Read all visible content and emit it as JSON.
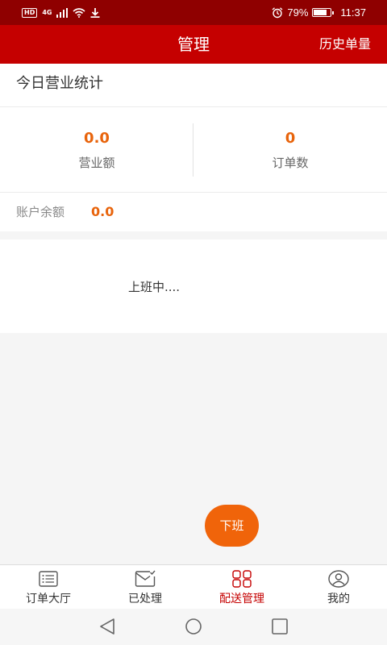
{
  "status_bar": {
    "hd": "HD",
    "network": "4G",
    "battery_percent": "79%",
    "battery_level": 0.79,
    "time": "11:37"
  },
  "header": {
    "title": "管理",
    "history_label": "历史单量"
  },
  "today_stats": {
    "section_title": "今日营业统计",
    "revenue_value": "0.0",
    "revenue_label": "营业额",
    "orders_value": "0",
    "orders_label": "订单数"
  },
  "balance": {
    "label": "账户余额",
    "value": "0.0"
  },
  "duty": {
    "status_text": "上班中....",
    "off_button_label": "下班"
  },
  "tabs": [
    {
      "label": "订单大厅",
      "icon": "order-list-icon",
      "active": false
    },
    {
      "label": "已处理",
      "icon": "envelope-check-icon",
      "active": false
    },
    {
      "label": "配送管理",
      "icon": "grid-icon",
      "active": true
    },
    {
      "label": "我的",
      "icon": "user-icon",
      "active": false
    }
  ],
  "colors": {
    "status_bar": "#8f0000",
    "header": "#c50000",
    "accent": "#e8640c",
    "active_tab": "#c50000"
  }
}
